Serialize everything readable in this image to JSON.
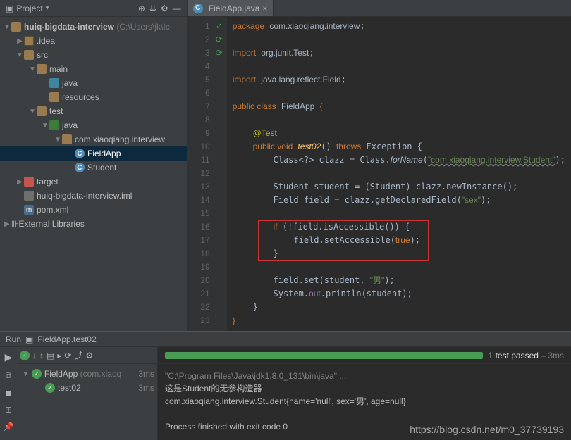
{
  "project": {
    "panel_title": "Project",
    "root": "huiq-bigdata-interview",
    "root_hint": "(C:\\Users\\jk\\Ic",
    "items": {
      "idea": ".idea",
      "src": "src",
      "main": "main",
      "java_main": "java",
      "resources": "resources",
      "test": "test",
      "java_test": "java",
      "pkg": "com.xiaoqiang.interview",
      "fieldapp": "FieldApp",
      "student": "Student",
      "target": "target",
      "iml": "huiq-bigdata-interview.iml",
      "pom": "pom.xml",
      "ext_libs": "External Libraries"
    }
  },
  "editor": {
    "tab": "FieldApp.java",
    "lines": [
      "1",
      "2",
      "3",
      "4",
      "5",
      "6",
      "7",
      "8",
      "9",
      "10",
      "11",
      "12",
      "13",
      "14",
      "15",
      "16",
      "17",
      "18",
      "19",
      "20",
      "21",
      "22",
      "23"
    ],
    "code": {
      "pkg": "com.xiaoqiang.interview",
      "import1": "org.junit.Test",
      "import2": "java.lang.reflect.Field",
      "classname": "FieldApp",
      "annotation": "@Test",
      "method": "test02",
      "exception": "Exception",
      "fqn": "\"com.xiaoqiang.interview.Student\"",
      "sexstr": "\"sex\"",
      "malestr": "\"男\"",
      "truekw": "true"
    }
  },
  "run": {
    "header": "FieldApp.test02",
    "tests_passed": "1 test passed",
    "duration": "3ms",
    "tree_root": "FieldApp",
    "tree_root_hint": "(com.xiaoq",
    "tree_root_ms": "3ms",
    "tree_child": "test02",
    "tree_child_ms": "3ms",
    "console": {
      "cmd": "\"C:\\Program Files\\Java\\jdk1.8.0_131\\bin\\java\" ...",
      "line1": "这是Student的无参构造器",
      "line2": "com.xiaoqiang.interview.Student{name='null', sex='男', age=null}",
      "line3": "Process finished with exit code 0"
    }
  },
  "watermark": "https://blog.csdn.net/m0_37739193"
}
